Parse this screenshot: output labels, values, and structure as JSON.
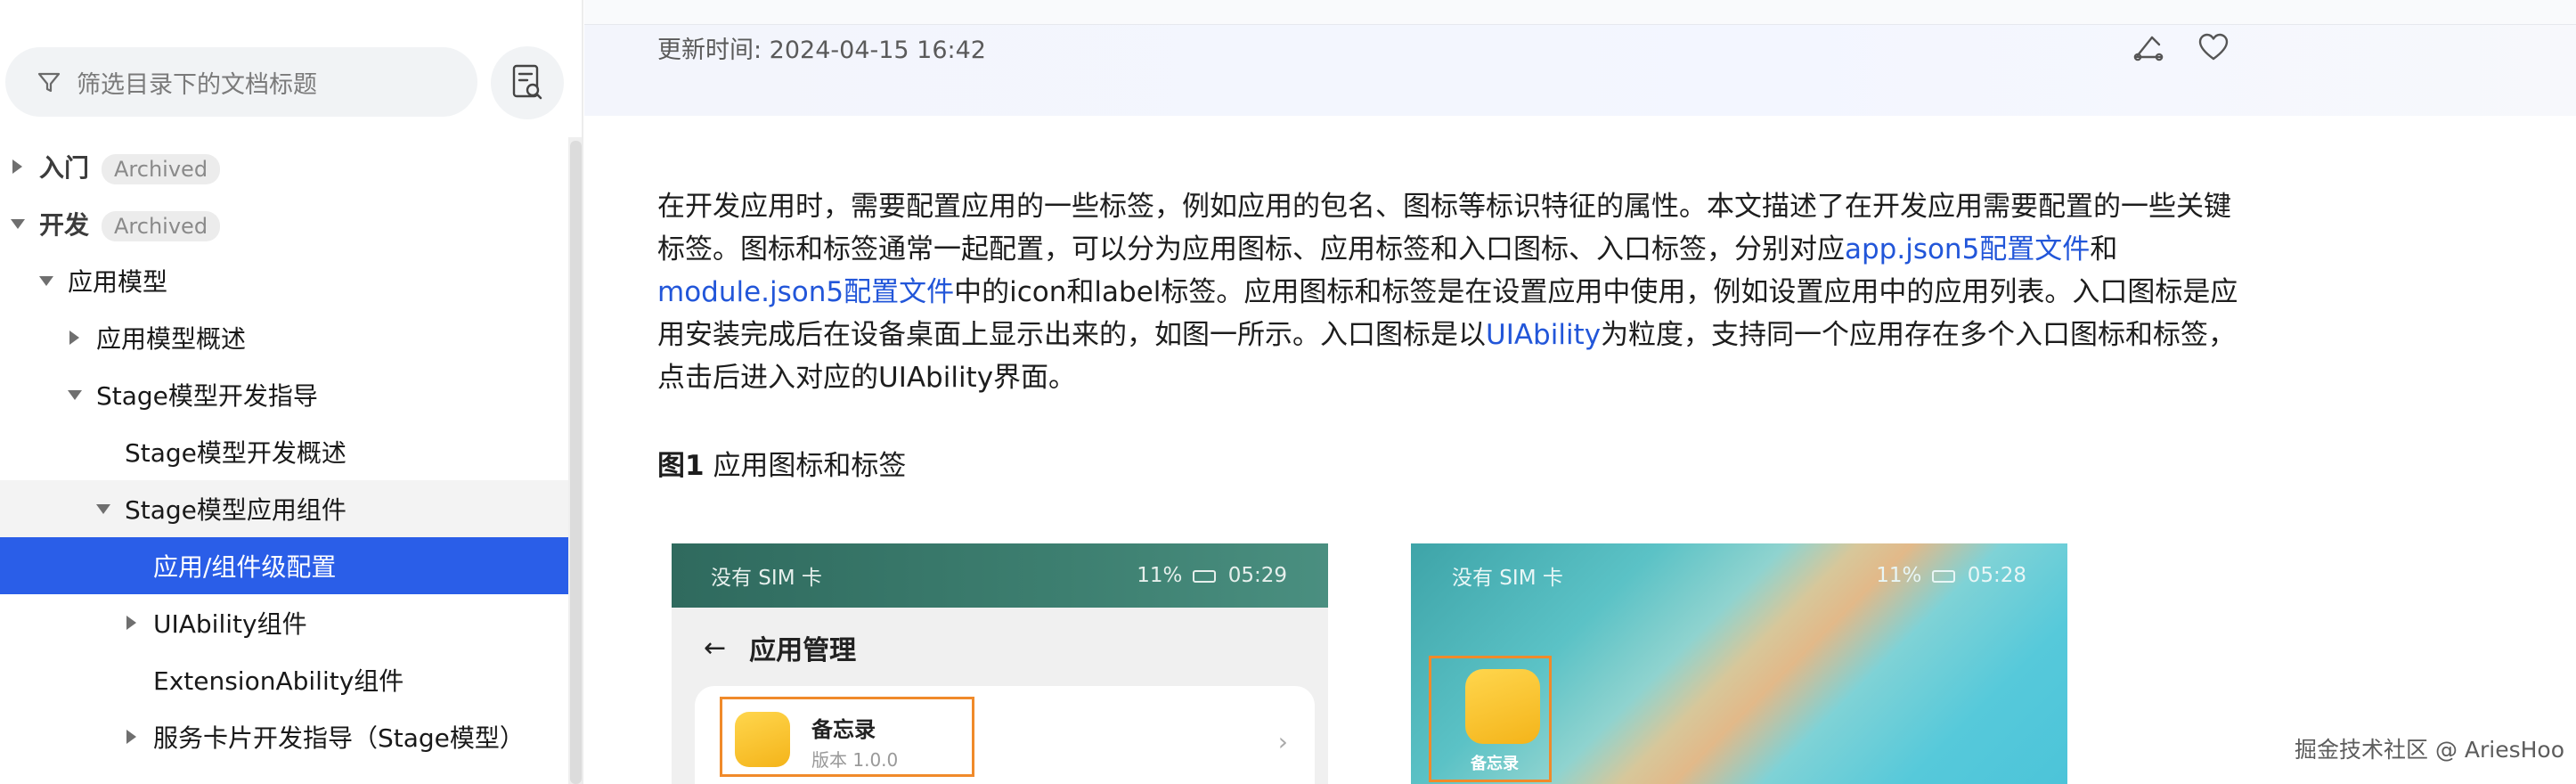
{
  "sidebar": {
    "filter_placeholder": "筛选目录下的文档标题",
    "items": [
      {
        "label": "入门",
        "badge": "Archived",
        "level": 0,
        "state": "collapsed"
      },
      {
        "label": "开发",
        "badge": "Archived",
        "level": 0,
        "state": "expanded"
      },
      {
        "label": "应用模型",
        "level": 1,
        "state": "expanded"
      },
      {
        "label": "应用模型概述",
        "level": 2,
        "state": "collapsed"
      },
      {
        "label": "Stage模型开发指导",
        "level": 2,
        "state": "expanded"
      },
      {
        "label": "Stage模型开发概述",
        "level": 3,
        "state": "leaf"
      },
      {
        "label": "Stage模型应用组件",
        "level": 3,
        "state": "expanded"
      },
      {
        "label": "应用/组件级配置",
        "level": 4,
        "state": "selected"
      },
      {
        "label": "UIAbility组件",
        "level": 4,
        "state": "collapsed"
      },
      {
        "label": "ExtensionAbility组件",
        "level": 4,
        "state": "leaf"
      },
      {
        "label": "服务卡片开发指导（Stage模型）",
        "level": 4,
        "state": "collapsed"
      }
    ]
  },
  "header": {
    "update_time": "更新时间: 2024-04-15 16:42"
  },
  "article": {
    "p1_a": "在开发应用时，需要配置应用的一些标签，例如应用的包名、图标等标识特征的属性。本文描述了在开发应用需要配置的一些关键标签。图标和标签通常一起配置，可以分为应用图标、应用标签和入口图标、入口标签，分别对应",
    "link1": "app.json5配置文件",
    "p1_b": "和",
    "link2": "module.json5配置文件",
    "p1_c": "中的icon和label标签。应用图标和标签是在设置应用中使用，例如设置应用中的应用列表。入口图标是应用安装完成后在设备桌面上显示出来的，如图一所示。入口图标是以",
    "link3": "UIAbility",
    "p1_d": "为粒度，支持同一个应用存在多个入口图标和标签，点击后进入对应的UIAbility界面。",
    "figure_label": "图1",
    "figure_title": "应用图标和标签"
  },
  "figure": {
    "left": {
      "carrier": "没有 SIM 卡",
      "battery": "11%",
      "time": "05:29",
      "title": "应用管理",
      "app_name": "备忘录",
      "app_version": "版本 1.0.0"
    },
    "right": {
      "carrier": "没有 SIM 卡",
      "battery": "11%",
      "time": "05:28",
      "app_name": "备忘录"
    }
  },
  "watermark": "掘金技术社区 @ AriesHoo",
  "colors": {
    "accent": "#2a5ee8",
    "link": "#2256d9",
    "highlight_box": "#f08a2a"
  }
}
